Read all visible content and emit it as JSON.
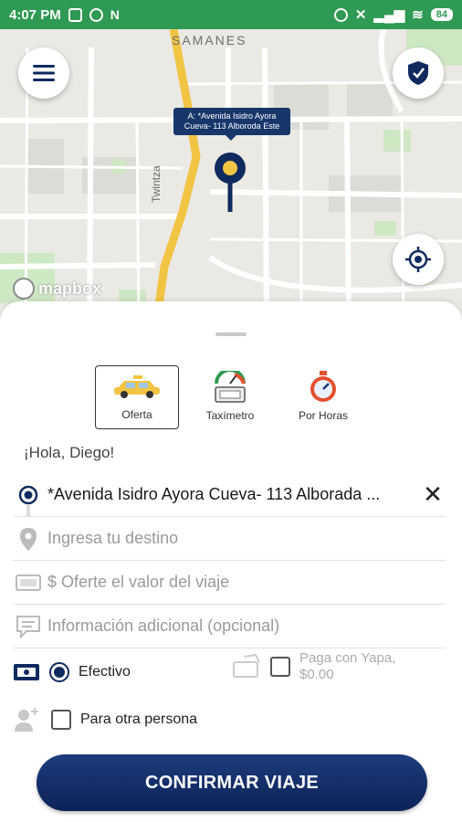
{
  "status_bar": {
    "time": "4:07 PM",
    "battery": "84",
    "left_icons": [
      "image-icon",
      "whatsapp-icon",
      "n-icon"
    ],
    "right_icons": [
      "alarm-icon",
      "mute-icon",
      "signal-icon",
      "wifi-icon"
    ]
  },
  "map": {
    "label_samanes": "SAMANES",
    "label_twintza": "Twintza",
    "attribution": "mapbox",
    "pin_tooltip": "A: *Avenida Isidro Ayora Cueva- 113 Alboroda Este"
  },
  "modes": [
    {
      "label": "Oferta",
      "icon": "taxi-icon",
      "active": true
    },
    {
      "label": "Taxímetro",
      "icon": "taximeter-icon",
      "active": false
    },
    {
      "label": "Por Horas",
      "icon": "stopwatch-icon",
      "active": false
    }
  ],
  "greeting": "¡Hola, Diego!",
  "origin": {
    "value": "*Avenida Isidro Ayora Cueva- 113 Alborada ..."
  },
  "destination": {
    "placeholder": "Ingresa tu destino"
  },
  "offer": {
    "placeholder": "$ Oferte el valor del viaje"
  },
  "info": {
    "placeholder": "Información adicional (opcional)"
  },
  "payment": {
    "label": "Efectivo",
    "selected": true
  },
  "yapa": {
    "line1": "Paga con Yapa,",
    "line2": "$0.00"
  },
  "other_person": {
    "label": "Para otra persona"
  },
  "confirm_button": "CONFIRMAR VIAJE",
  "colors": {
    "status_bar": "#2f9a53",
    "primary": "#0e2a5e",
    "map_road": "#f2c443"
  }
}
